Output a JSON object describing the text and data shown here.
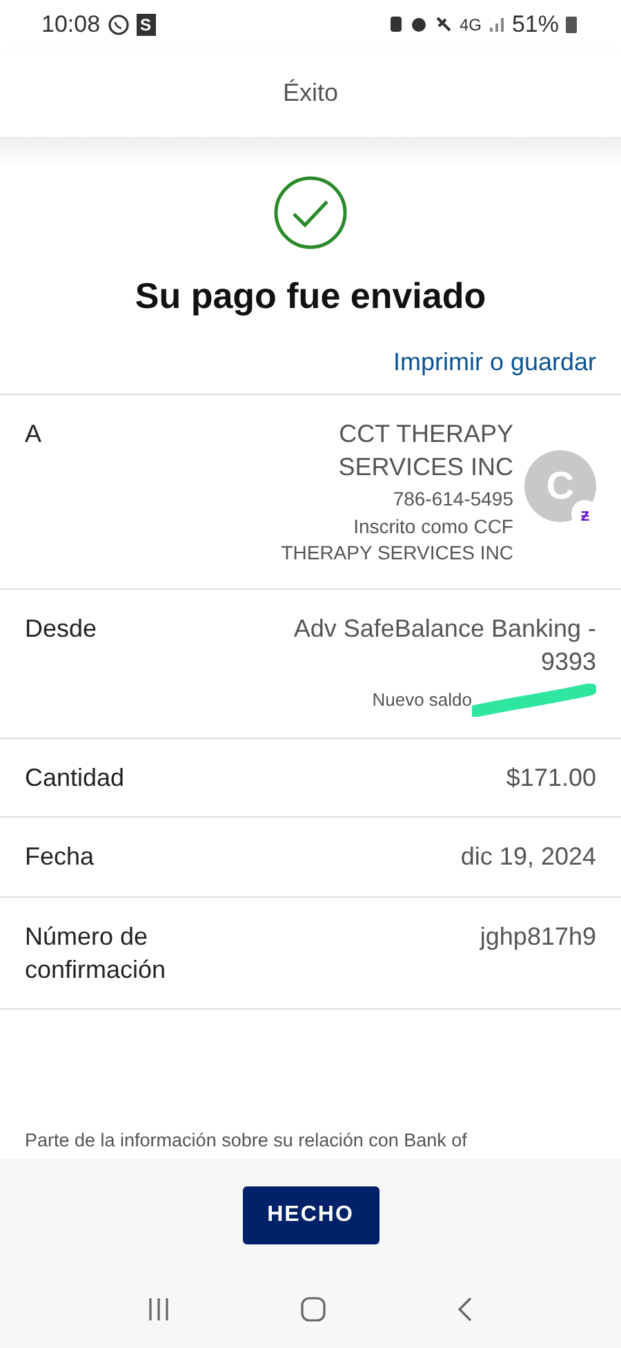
{
  "status_bar": {
    "time": "10:08",
    "app_badge": "S",
    "network": "4G",
    "battery": "51%"
  },
  "header": {
    "title": "Éxito"
  },
  "confirmation": {
    "title": "Su pago fue enviado",
    "print_link": "Imprimir o guardar"
  },
  "recipient": {
    "label": "A",
    "name_lines": [
      "CCT THERAPY",
      "SERVICES INC"
    ],
    "phone": "786-614-5495",
    "enrolled_lines": [
      "Inscrito como CCF",
      "THERAPY SERVICES INC"
    ],
    "avatar": "C",
    "avatar_badge": "ƶ"
  },
  "from": {
    "label": "Desde",
    "account_lines": [
      "Adv SafeBalance Banking -",
      "9393"
    ],
    "balance_label": "Nuevo saldo"
  },
  "details": [
    {
      "label": "Cantidad",
      "value": "$171.00"
    },
    {
      "label": "Fecha",
      "value": "dic 19, 2024"
    },
    {
      "label": "Número de confirmación",
      "value": "jghp817h9"
    }
  ],
  "disclaimer": "Parte de la información sobre su relación con Bank of",
  "done_button": "HECHO"
}
